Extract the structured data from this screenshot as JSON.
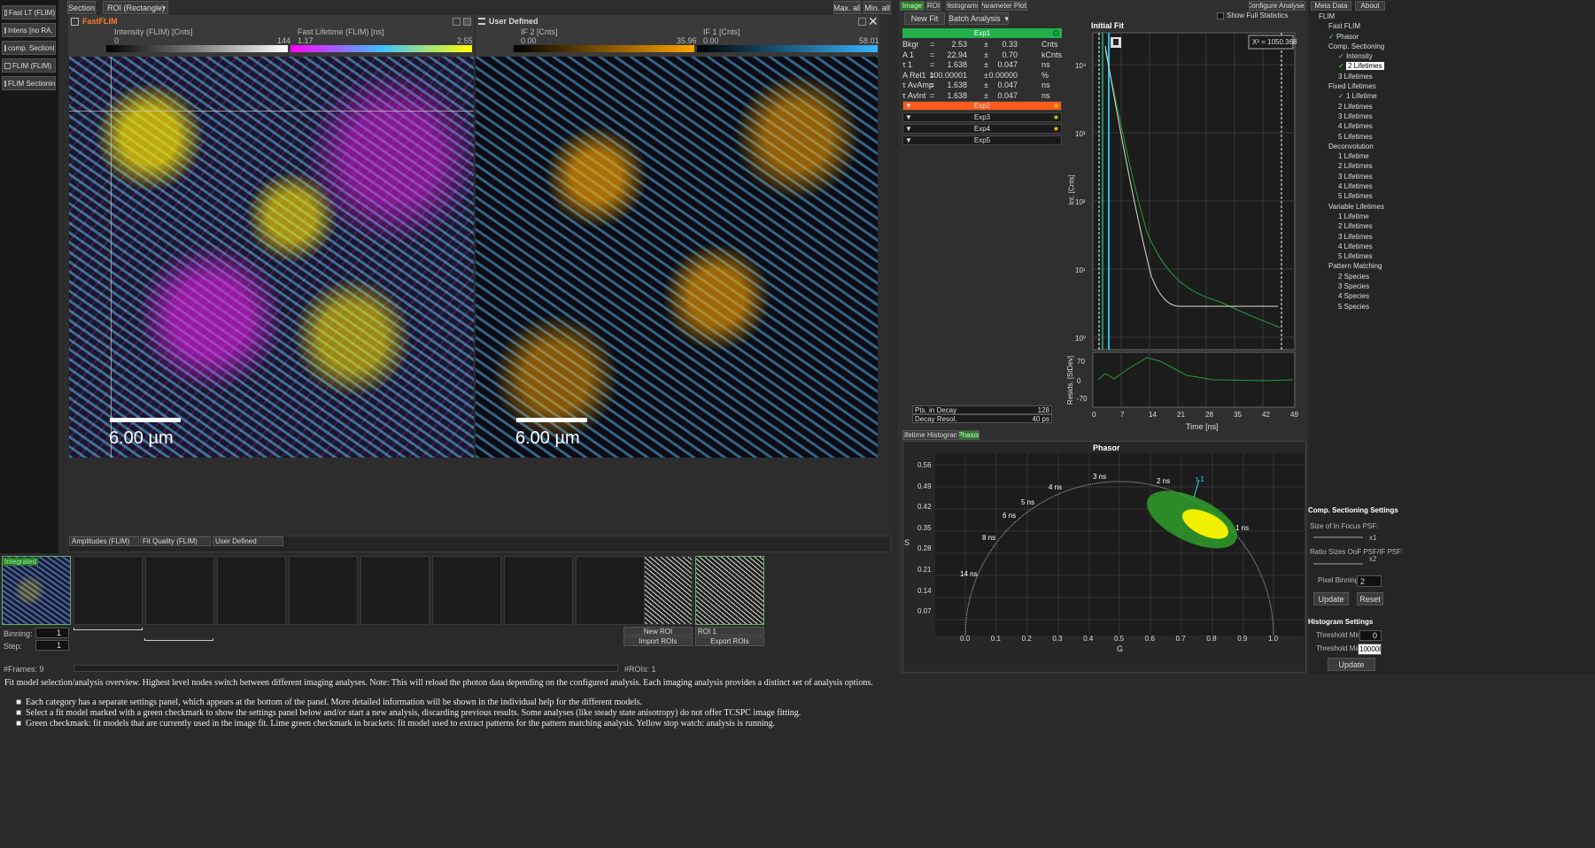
{
  "left_tabs": [
    {
      "label": "Fast LT (FLIM)"
    },
    {
      "label": "Intens [no RA, S"
    },
    {
      "label": "comp. Sectionin"
    },
    {
      "label": "FLIM (FLIM)"
    },
    {
      "label": "FLIM Sectioning"
    }
  ],
  "top_toolbar": {
    "section": "Section",
    "roi_mode": "ROI (Rectangle)",
    "max_all": "Max. all",
    "min_all": "Min. all"
  },
  "image_left": {
    "title": "FastFLIM",
    "cbar1": {
      "label": "Intensity (FLIM) [Cnts]",
      "min": "0",
      "max": "144"
    },
    "cbar2": {
      "label": "Fast Lifetime (FLIM) [ns]",
      "min": "1.17",
      "max": "2.55"
    },
    "scalebar": "6.00 µm"
  },
  "image_right": {
    "title": "User Defined",
    "cbar1": {
      "label": "IF 2 [Cnts]",
      "min": "0.00",
      "max": "35.96"
    },
    "cbar2": {
      "label": "IF 1 [Cnts]",
      "min": "0.00",
      "max": "58.01"
    },
    "scalebar": "6.00 µm"
  },
  "bottom_image_tabs": [
    "Amplitudes (FLIM)",
    "Fit Quality (FLIM)",
    "User Defined"
  ],
  "frames": {
    "integrated_label": "Integrated",
    "binning_label": "Binning:",
    "binning": "1",
    "step_label": "Step:",
    "step": "1",
    "frames_count": "#Frames: 9"
  },
  "rois": {
    "new_roi": "New ROI",
    "roi1": "ROI 1",
    "import": "Import ROIs",
    "export": "Export ROIs",
    "count": "#ROIs: 1"
  },
  "help": {
    "intro": "Fit model selection/analysis overview. Highest level nodes switch between different imaging analyses. Note: This will reload the photon data depending on the configured analysis. Each imaging analysis provides a distinct set of analysis options.",
    "bullets": [
      "Each category has a separate settings panel, which appears at the bottom of the panel. More detailed information will be shown in the individual help for the different models.",
      "Select a fit model marked with a green checkmark to show the settings panel below and/or start a new analysis, discarding previous results. Some analyses (like steady state anisotropy) do not offer TCSPC image fitting.",
      "Green checkmark: fit models that are currently used in the image fit. Lime green checkmark in brackets: fit model used to extract patterns for the pattern matching analysis. Yellow stop watch: analysis is running."
    ]
  },
  "analysis_tabs": [
    "Image",
    "ROI",
    "Histograms",
    "Parameter Plots"
  ],
  "analysis_buttons": {
    "new_fit": "New Fit",
    "batch": "Batch Analysis"
  },
  "exp1": {
    "label": "Exp1",
    "params": [
      {
        "name": "Bkgr",
        "eq": "=",
        "val": "2.53",
        "pm": "±",
        "err": "0.33",
        "unit": "Cnts"
      },
      {
        "name": "A 1",
        "eq": "=",
        "val": "22.94",
        "pm": "±",
        "err": "0.70",
        "unit": "kCnts"
      },
      {
        "name": "τ 1",
        "eq": "=",
        "val": "1.638",
        "pm": "±",
        "err": "0.047",
        "unit": "ns"
      },
      {
        "name": "A Rel1",
        "eq": "=",
        "val": "100.00001",
        "pm": "±",
        "err": "0.00000",
        "unit": "%"
      },
      {
        "name": "τ AvAmp",
        "eq": "=",
        "val": "1.638",
        "pm": "±",
        "err": "0.047",
        "unit": "ns"
      },
      {
        "name": "τ AvInt",
        "eq": "=",
        "val": "1.638",
        "pm": "±",
        "err": "0.047",
        "unit": "ns"
      }
    ]
  },
  "exp_rows": [
    "Exp2",
    "Exp3",
    "Exp4",
    "Exp5"
  ],
  "decay_info": [
    {
      "label": "Pts. in Decay",
      "value": "128"
    },
    {
      "label": "Decay Resol.",
      "value": "40 ps"
    }
  ],
  "fit_plot": {
    "title": "Initial Fit",
    "show_full_stats": "Show Full Statistics",
    "chi2": "X² = 1050.368",
    "ylabel": "Int. [Cnts]",
    "resid_label": "Resids. [StDev]",
    "xlabel": "Time [ns]",
    "y_ticks": [
      "10⁴",
      "10³",
      "10²",
      "10¹",
      "10⁰"
    ],
    "resid_ticks": [
      "70",
      "0",
      "-70"
    ],
    "x_ticks": [
      "0",
      "7",
      "14",
      "21",
      "28",
      "35",
      "42",
      "49"
    ]
  },
  "lower_tabs": [
    "Lifetime Histogram",
    "Phasor"
  ],
  "phasor": {
    "title": "Phasor",
    "xlabel": "G",
    "ylabel": "S",
    "x_ticks": [
      "0.0",
      "0.1",
      "0.2",
      "0.3",
      "0.4",
      "0.5",
      "0.6",
      "0.7",
      "0.8",
      "0.9",
      "1.0"
    ],
    "y_ticks": [
      "0.56",
      "0.49",
      "0.42",
      "0.35",
      "0.28",
      "0.21",
      "0.14",
      "0.07"
    ],
    "ns_labels": [
      "3 ns",
      "2 ns",
      "τ 1",
      "4 ns",
      "5 ns",
      "6 ns",
      "1 ns",
      "8 ns",
      "14 ns"
    ]
  },
  "right_top": {
    "configure": "Configure Analyses",
    "meta": "Meta Data",
    "about": "About"
  },
  "tree": [
    {
      "label": "FLIM",
      "lvl": 0,
      "c": false
    },
    {
      "label": "Fast FLIM",
      "lvl": 1,
      "c": false
    },
    {
      "label": "Phasor",
      "lvl": 1,
      "c": true
    },
    {
      "label": "Comp. Sectioning",
      "lvl": 1,
      "c": false
    },
    {
      "label": "Intensity",
      "lvl": 2,
      "c": true
    },
    {
      "label": "2 Lifetimes",
      "lvl": 2,
      "c": true,
      "sel": true
    },
    {
      "label": "3 Lifetimes",
      "lvl": 2,
      "c": false
    },
    {
      "label": "Fixed Lifetimes",
      "lvl": 1,
      "c": false
    },
    {
      "label": "1 Lifetime",
      "lvl": 2,
      "c": true
    },
    {
      "label": "2 Lifetimes",
      "lvl": 2,
      "c": false
    },
    {
      "label": "3 Lifetimes",
      "lvl": 2,
      "c": false
    },
    {
      "label": "4 Lifetimes",
      "lvl": 2,
      "c": false
    },
    {
      "label": "5 Lifetimes",
      "lvl": 2,
      "c": false
    },
    {
      "label": "Deconvolution",
      "lvl": 1,
      "c": false
    },
    {
      "label": "1 Lifetime",
      "lvl": 2,
      "c": false
    },
    {
      "label": "2 Lifetimes",
      "lvl": 2,
      "c": false
    },
    {
      "label": "3 Lifetimes",
      "lvl": 2,
      "c": false
    },
    {
      "label": "4 Lifetimes",
      "lvl": 2,
      "c": false
    },
    {
      "label": "5 Lifetimes",
      "lvl": 2,
      "c": false
    },
    {
      "label": "Variable Lifetimes",
      "lvl": 1,
      "c": false
    },
    {
      "label": "1 Lifetime",
      "lvl": 2,
      "c": false
    },
    {
      "label": "2 Lifetimes",
      "lvl": 2,
      "c": false
    },
    {
      "label": "3 Lifetimes",
      "lvl": 2,
      "c": false
    },
    {
      "label": "4 Lifetimes",
      "lvl": 2,
      "c": false
    },
    {
      "label": "5 Lifetimes",
      "lvl": 2,
      "c": false
    },
    {
      "label": "Pattern Matching",
      "lvl": 1,
      "c": false
    },
    {
      "label": "2 Species",
      "lvl": 2,
      "c": false
    },
    {
      "label": "3 Species",
      "lvl": 2,
      "c": false
    },
    {
      "label": "4 Species",
      "lvl": 2,
      "c": false
    },
    {
      "label": "5 Species",
      "lvl": 2,
      "c": false
    }
  ],
  "comp_settings": {
    "title": "Comp. Sectioning Settings",
    "psf_label": "Size of In Focus PSF:",
    "psf_val": "x1",
    "ratio_label": "Ratio Sizes OoF PSF/IF PSF:",
    "ratio_val": "x2",
    "pixel_binning_label": "Pixel Binning:",
    "pixel_binning": "2",
    "update": "Update",
    "reset": "Reset"
  },
  "hist_settings": {
    "title": "Histogram Settings",
    "min_label": "Threshold Min:",
    "min": "0",
    "max_label": "Threshold Max:",
    "max": "100000",
    "update": "Update"
  }
}
